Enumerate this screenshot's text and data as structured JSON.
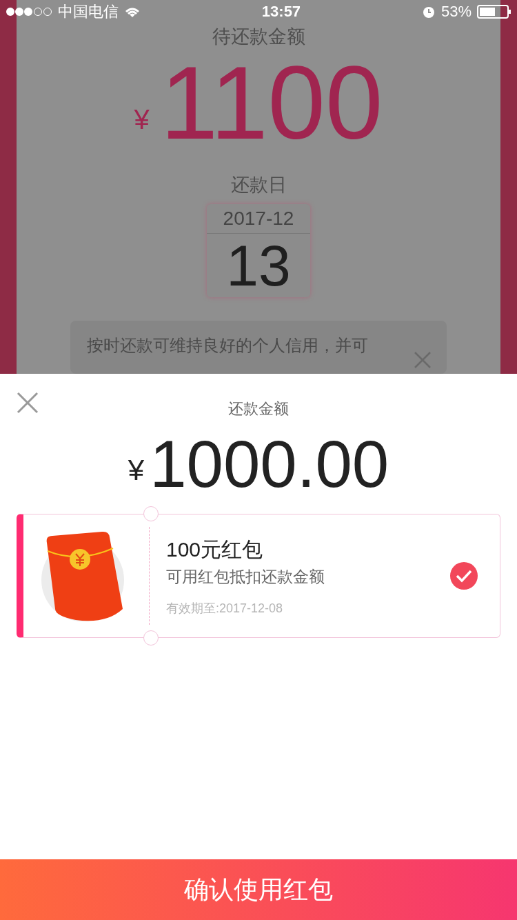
{
  "status_bar": {
    "carrier": "中国电信",
    "time": "13:57",
    "battery": "53%"
  },
  "background_page": {
    "amount_label": "待还款金额",
    "currency": "¥",
    "amount": "1100",
    "date_label": "还款日",
    "month": "2017-12",
    "day": "13",
    "notice": "按时还款可维持良好的个人信用，并可"
  },
  "sheet": {
    "title": "还款金额",
    "currency": "¥",
    "amount": "1000.00",
    "coupons": [
      {
        "title": "100元红包",
        "description": "可用红包抵扣还款金额",
        "validity": "有效期至:2017-12-08",
        "selected": true
      }
    ],
    "confirm_button": "确认使用红包"
  }
}
